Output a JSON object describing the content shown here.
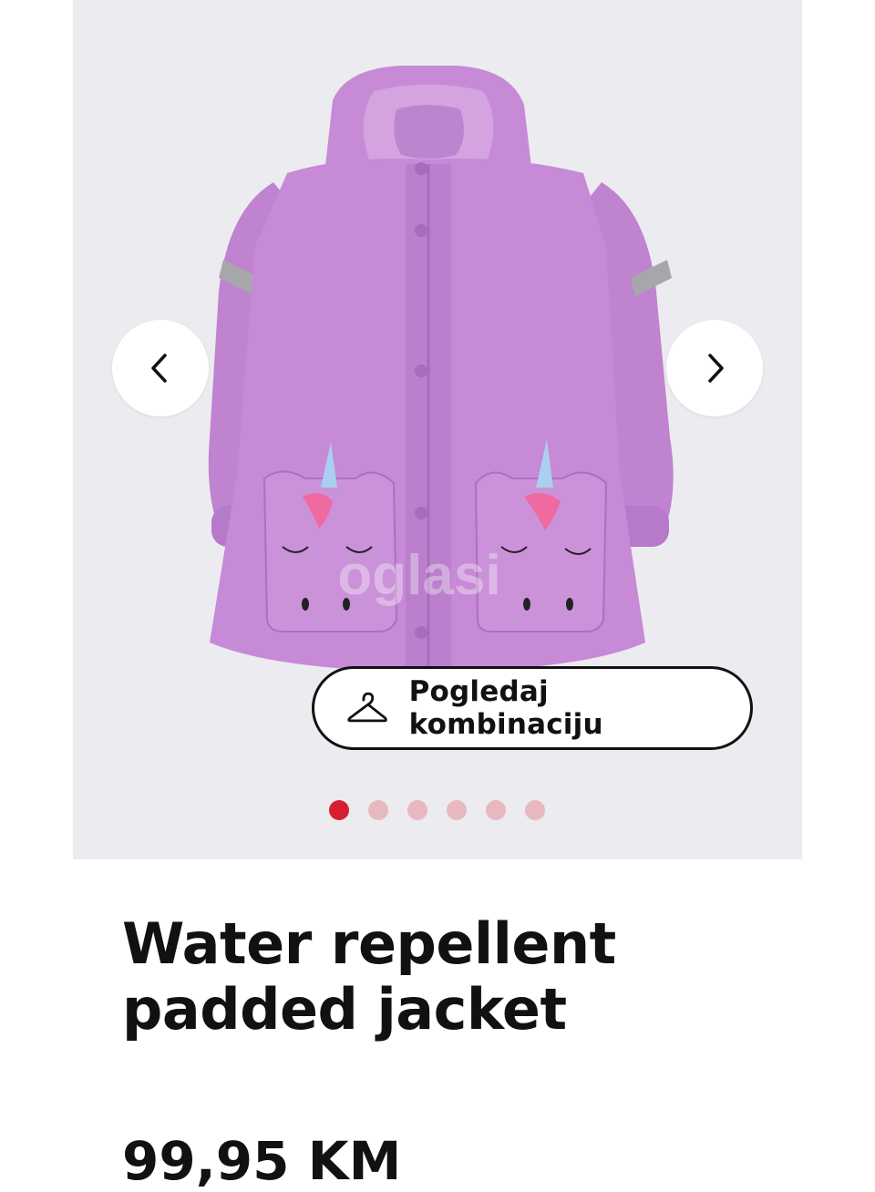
{
  "gallery": {
    "watermark": "oglasi",
    "outfit_button_label": "Pogledaj kombinaciju",
    "slide_count": 6,
    "active_slide": 1,
    "colors": {
      "jacket": "#c68ad6",
      "active_dot": "#d7202f",
      "inactive_dot": "#e8b8c0"
    }
  },
  "product": {
    "title": "Water repellent padded jacket",
    "price": "99,95 KM"
  },
  "icons": {
    "prev": "chevron-left-icon",
    "next": "chevron-right-icon",
    "outfit": "hanger-icon"
  }
}
